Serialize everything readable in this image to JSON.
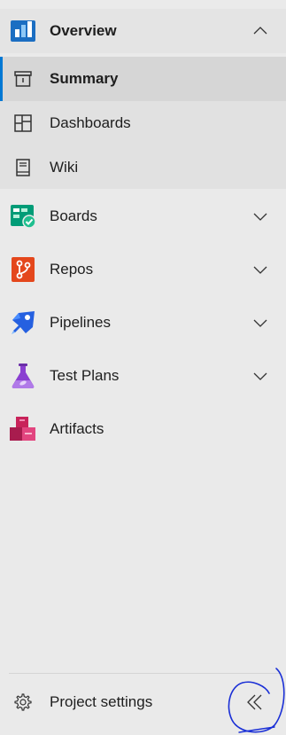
{
  "nav": {
    "overview": {
      "label": "Overview",
      "icon": "overview-icon",
      "expanded": true
    },
    "overview_items": [
      {
        "label": "Summary",
        "icon": "summary-icon",
        "selected": true
      },
      {
        "label": "Dashboards",
        "icon": "dashboards-icon"
      },
      {
        "label": "Wiki",
        "icon": "wiki-icon"
      }
    ],
    "sections": [
      {
        "label": "Boards",
        "icon": "boards-icon"
      },
      {
        "label": "Repos",
        "icon": "repos-icon"
      },
      {
        "label": "Pipelines",
        "icon": "pipelines-icon"
      },
      {
        "label": "Test Plans",
        "icon": "test-plans-icon"
      },
      {
        "label": "Artifacts",
        "icon": "artifacts-icon"
      }
    ],
    "footer": {
      "settings_label": "Project settings",
      "settings_icon": "gear-icon",
      "collapse_icon": "double-chevron-left-icon"
    }
  },
  "colors": {
    "selection_accent": "#0078d4",
    "annotation": "#1a2fd6"
  }
}
